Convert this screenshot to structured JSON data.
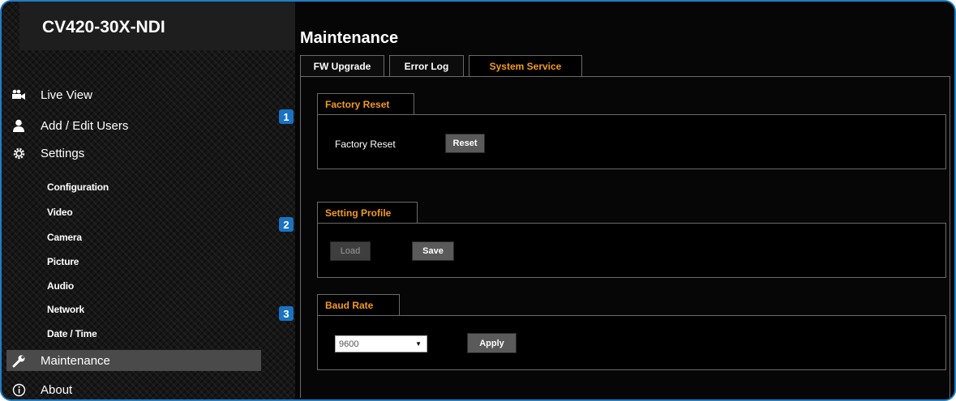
{
  "device": {
    "model": "CV420-30X-NDI"
  },
  "sidebar": {
    "main_items": [
      {
        "label": "Live View",
        "icon": "video-camera-icon"
      },
      {
        "label": "Add / Edit Users",
        "icon": "user-icon"
      },
      {
        "label": "Settings",
        "icon": "gear-icon"
      }
    ],
    "settings_items": [
      "Configuration",
      "Video",
      "Camera",
      "Picture",
      "Audio",
      "Network",
      "Date / Time"
    ],
    "maintenance": {
      "label": "Maintenance",
      "icon": "wrench-icon",
      "active": true
    },
    "about": {
      "label": "About",
      "icon": "info-icon"
    }
  },
  "page": {
    "title": "Maintenance",
    "tabs": [
      {
        "label": "FW Upgrade",
        "active": false
      },
      {
        "label": "Error Log",
        "active": false
      },
      {
        "label": "System Service",
        "active": true
      }
    ]
  },
  "sections": {
    "factory_reset": {
      "badge": "1",
      "title": "Factory Reset",
      "label": "Factory Reset",
      "button": "Reset"
    },
    "setting_profile": {
      "badge": "2",
      "title": "Setting Profile",
      "load_button": "Load",
      "save_button": "Save"
    },
    "baud_rate": {
      "badge": "3",
      "title": "Baud Rate",
      "selected": "9600",
      "apply_button": "Apply"
    }
  },
  "colors": {
    "accent": "#f39a1f",
    "badge": "#1a73c2",
    "frame_border": "#1f7ec4"
  }
}
